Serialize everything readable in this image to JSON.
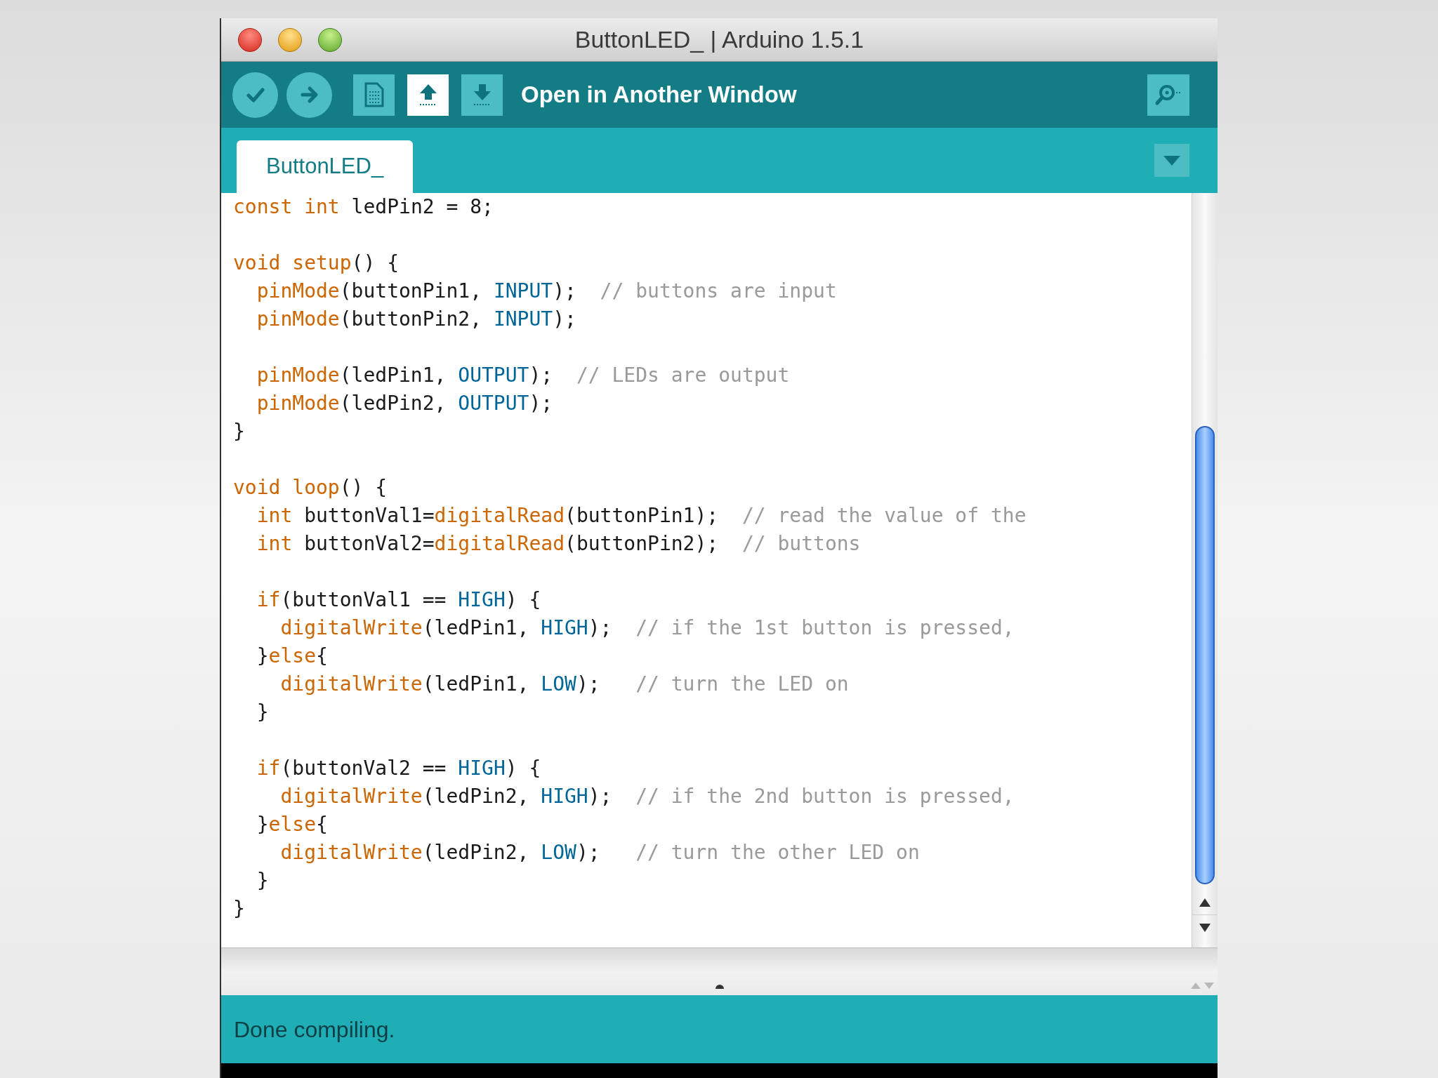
{
  "window": {
    "title": "ButtonLED_ | Arduino 1.5.1"
  },
  "toolbar": {
    "buttons": [
      {
        "kind": "verify",
        "hovered": false
      },
      {
        "kind": "upload",
        "hovered": false
      },
      {
        "kind": "new",
        "hovered": false
      },
      {
        "kind": "open",
        "hovered": true
      },
      {
        "kind": "save",
        "hovered": false
      }
    ],
    "hint": "Open in Another Window"
  },
  "tabs": [
    {
      "label": "ButtonLED_",
      "selected": true
    }
  ],
  "editor": {
    "lines": [
      {
        "kind": "code",
        "tokens": [
          {
            "t": "const",
            "kind": "kw"
          },
          {
            "t": " int",
            "kind": "kw"
          },
          {
            "t": " ledPin2 = 8;",
            "kind": "plain"
          }
        ]
      },
      {
        "kind": "blank"
      },
      {
        "kind": "code",
        "tokens": [
          {
            "t": "void",
            "kind": "kw"
          },
          {
            "t": " setup",
            "kind": "fn"
          },
          {
            "t": "() {",
            "kind": "plain"
          }
        ]
      },
      {
        "kind": "code",
        "tokens": [
          {
            "t": "  pinMode",
            "kind": "fn"
          },
          {
            "t": "(buttonPin1, ",
            "kind": "plain"
          },
          {
            "t": "INPUT",
            "kind": "const"
          },
          {
            "t": ");  ",
            "kind": "plain"
          },
          {
            "t": "// buttons are input",
            "kind": "comment"
          }
        ]
      },
      {
        "kind": "code",
        "tokens": [
          {
            "t": "  pinMode",
            "kind": "fn"
          },
          {
            "t": "(buttonPin2, ",
            "kind": "plain"
          },
          {
            "t": "INPUT",
            "kind": "const"
          },
          {
            "t": ");",
            "kind": "plain"
          }
        ]
      },
      {
        "kind": "blank"
      },
      {
        "kind": "code",
        "tokens": [
          {
            "t": "  pinMode",
            "kind": "fn"
          },
          {
            "t": "(ledPin1, ",
            "kind": "plain"
          },
          {
            "t": "OUTPUT",
            "kind": "const"
          },
          {
            "t": ");  ",
            "kind": "plain"
          },
          {
            "t": "// LEDs are output",
            "kind": "comment"
          }
        ]
      },
      {
        "kind": "code",
        "tokens": [
          {
            "t": "  pinMode",
            "kind": "fn"
          },
          {
            "t": "(ledPin2, ",
            "kind": "plain"
          },
          {
            "t": "OUTPUT",
            "kind": "const"
          },
          {
            "t": ");",
            "kind": "plain"
          }
        ]
      },
      {
        "kind": "code",
        "tokens": [
          {
            "t": "}",
            "kind": "plain"
          }
        ]
      },
      {
        "kind": "blank"
      },
      {
        "kind": "code",
        "tokens": [
          {
            "t": "void",
            "kind": "kw"
          },
          {
            "t": " loop",
            "kind": "fn"
          },
          {
            "t": "() {",
            "kind": "plain"
          }
        ]
      },
      {
        "kind": "code",
        "tokens": [
          {
            "t": "  int",
            "kind": "kw"
          },
          {
            "t": " buttonVal1=",
            "kind": "plain"
          },
          {
            "t": "digitalRead",
            "kind": "fn"
          },
          {
            "t": "(buttonPin1);  ",
            "kind": "plain"
          },
          {
            "t": "// read the value of the",
            "kind": "comment"
          }
        ]
      },
      {
        "kind": "code",
        "tokens": [
          {
            "t": "  int",
            "kind": "kw"
          },
          {
            "t": " buttonVal2=",
            "kind": "plain"
          },
          {
            "t": "digitalRead",
            "kind": "fn"
          },
          {
            "t": "(buttonPin2);  ",
            "kind": "plain"
          },
          {
            "t": "// buttons",
            "kind": "comment"
          }
        ]
      },
      {
        "kind": "blank"
      },
      {
        "kind": "code",
        "tokens": [
          {
            "t": "  if",
            "kind": "kw"
          },
          {
            "t": "(buttonVal1 == ",
            "kind": "plain"
          },
          {
            "t": "HIGH",
            "kind": "const"
          },
          {
            "t": ") {",
            "kind": "plain"
          }
        ]
      },
      {
        "kind": "code",
        "tokens": [
          {
            "t": "    digitalWrite",
            "kind": "fn"
          },
          {
            "t": "(ledPin1, ",
            "kind": "plain"
          },
          {
            "t": "HIGH",
            "kind": "const"
          },
          {
            "t": ");  ",
            "kind": "plain"
          },
          {
            "t": "// if the 1st button is pressed,",
            "kind": "comment"
          }
        ]
      },
      {
        "kind": "code",
        "tokens": [
          {
            "t": "  }",
            "kind": "plain"
          },
          {
            "t": "else",
            "kind": "kw"
          },
          {
            "t": "{",
            "kind": "plain"
          }
        ]
      },
      {
        "kind": "code",
        "tokens": [
          {
            "t": "    digitalWrite",
            "kind": "fn"
          },
          {
            "t": "(ledPin1, ",
            "kind": "plain"
          },
          {
            "t": "LOW",
            "kind": "const"
          },
          {
            "t": ");   ",
            "kind": "plain"
          },
          {
            "t": "// turn the LED on",
            "kind": "comment"
          }
        ]
      },
      {
        "kind": "code",
        "tokens": [
          {
            "t": "  }",
            "kind": "plain"
          }
        ]
      },
      {
        "kind": "blank"
      },
      {
        "kind": "code",
        "tokens": [
          {
            "t": "  if",
            "kind": "kw"
          },
          {
            "t": "(buttonVal2 == ",
            "kind": "plain"
          },
          {
            "t": "HIGH",
            "kind": "const"
          },
          {
            "t": ") {",
            "kind": "plain"
          }
        ]
      },
      {
        "kind": "code",
        "tokens": [
          {
            "t": "    digitalWrite",
            "kind": "fn"
          },
          {
            "t": "(ledPin2, ",
            "kind": "plain"
          },
          {
            "t": "HIGH",
            "kind": "const"
          },
          {
            "t": ");  ",
            "kind": "plain"
          },
          {
            "t": "// if the 2nd button is pressed,",
            "kind": "comment"
          }
        ]
      },
      {
        "kind": "code",
        "tokens": [
          {
            "t": "  }",
            "kind": "plain"
          },
          {
            "t": "else",
            "kind": "kw"
          },
          {
            "t": "{",
            "kind": "plain"
          }
        ]
      },
      {
        "kind": "code",
        "tokens": [
          {
            "t": "    digitalWrite",
            "kind": "fn"
          },
          {
            "t": "(ledPin2, ",
            "kind": "plain"
          },
          {
            "t": "LOW",
            "kind": "const"
          },
          {
            "t": ");   ",
            "kind": "plain"
          },
          {
            "t": "// turn the other LED on",
            "kind": "comment"
          }
        ]
      },
      {
        "kind": "code",
        "tokens": [
          {
            "t": "  }",
            "kind": "plain"
          }
        ]
      },
      {
        "kind": "code",
        "tokens": [
          {
            "t": "}",
            "kind": "plain"
          }
        ]
      }
    ]
  },
  "status_bar": {
    "message": "Done compiling."
  }
}
